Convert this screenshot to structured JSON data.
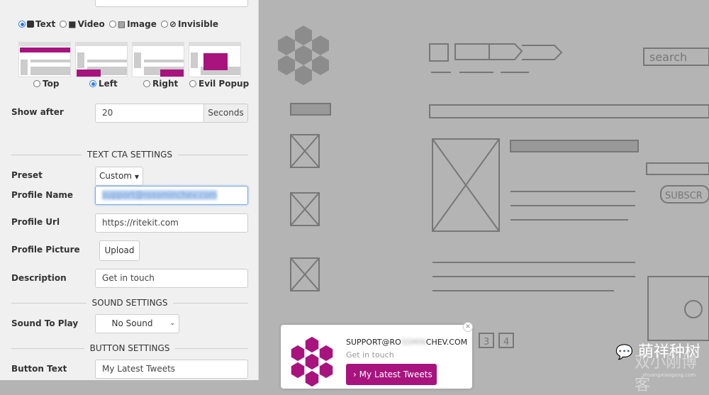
{
  "cta_types": [
    {
      "label": "Text",
      "selected": true,
      "icon": "square-icon"
    },
    {
      "label": "Video",
      "selected": false,
      "icon": "video-camera-icon"
    },
    {
      "label": "Image",
      "selected": false,
      "icon": "image-icon"
    },
    {
      "label": "Invisible",
      "selected": false,
      "icon": "eye-slash-icon"
    }
  ],
  "positions": [
    {
      "label": "Top",
      "selected": false
    },
    {
      "label": "Left",
      "selected": true
    },
    {
      "label": "Right",
      "selected": false
    },
    {
      "label": "Evil Popup",
      "selected": false
    }
  ],
  "show_after": {
    "label": "Show after",
    "value": "20",
    "unit": "Seconds"
  },
  "text_cta": {
    "heading": "TEXT CTA SETTINGS",
    "preset_label": "Preset",
    "preset_value": "Custom",
    "profile_name_label": "Profile Name",
    "profile_name_value": "support@rossminchev.com",
    "profile_url_label": "Profile Url",
    "profile_url_value": "https://ritekit.com",
    "profile_picture_label": "Profile Picture",
    "upload_label": "Upload",
    "description_label": "Description",
    "description_value": "Get in touch"
  },
  "sound": {
    "heading": "SOUND SETTINGS",
    "label": "Sound To Play",
    "value": "No Sound"
  },
  "button": {
    "heading": "BUTTON SETTINGS",
    "label": "Button Text",
    "value": "My Latest Tweets"
  },
  "popup": {
    "name": "SUPPORT@RO",
    "name_blurred": "SSMIN",
    "name_end": "CHEV.COM",
    "description": "Get in touch",
    "cta": "My Latest Tweets",
    "close": "×"
  },
  "sketch": {
    "search": "search",
    "subscribe": "SUBSCR",
    "pages": [
      "3",
      "4"
    ]
  },
  "watermark": {
    "title": "萌祥种树",
    "blog": "双小刚博客",
    "url": "shuangxiaogang.com"
  },
  "colors": {
    "accent": "#a8137e",
    "radio": "#2a7ae2"
  }
}
